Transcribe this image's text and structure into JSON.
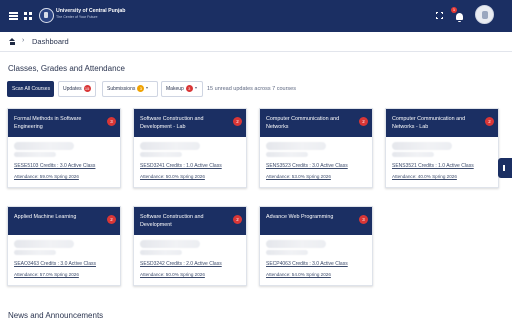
{
  "header": {
    "university_name": "University of Central Punjab",
    "tagline": "The Center of Your Future",
    "icons": [
      "menu-icon",
      "apps-icon",
      "fullscreen-icon",
      "bell-icon",
      "avatar"
    ],
    "notification_count": "1"
  },
  "breadcrumb": {
    "home_icon": "home-icon",
    "separator": "›",
    "current": "Dashboard"
  },
  "courses_section": {
    "title": "Classes, Grades and Attendance"
  },
  "filters": {
    "scan_all": "Scan All Courses",
    "updates_label": "Updates",
    "updates_count": "15",
    "submissions_label": "Submissions",
    "submissions_count": "3",
    "makeup_label": "Makeup",
    "makeup_count": "3",
    "summary": "15 unread updates across 7 courses"
  },
  "courses": [
    {
      "title": "Formal Methods in Software Engineering",
      "badge": "3",
      "code_line": "SESE5103 Credits : 3.0 Active Class",
      "attendance": "Attendance: 59.0% Spring 2026"
    },
    {
      "title": "Software Construction and Development - Lab",
      "badge": "2",
      "code_line": "SESD3241 Credits : 1.0 Active Class",
      "attendance": "Attendance: 50.0% Spring 2026"
    },
    {
      "title": "Computer Communication and Networks",
      "badge": "2",
      "code_line": "SENS3523 Credits : 3.0 Active Class",
      "attendance": "Attendance: 53.0% Spring 2026"
    },
    {
      "title": "Computer Communication and Networks - Lab",
      "badge": "2",
      "code_line": "SENS3521 Credits : 1.0 Active Class",
      "attendance": "Attendance: 40.0% Spring 2026"
    },
    {
      "title": "Applied Machine Learning",
      "badge": "2",
      "code_line": "SEAO3463 Credits : 3.0 Active Class",
      "attendance": "Attendance: 57.0% Spring 2026"
    },
    {
      "title": "Software Construction and Development",
      "badge": "2",
      "code_line": "SESD3242 Credits : 2.0 Active Class",
      "attendance": "Attendance: 50.0% Spring 2026"
    },
    {
      "title": "Advance Web Programming",
      "badge": "3",
      "code_line": "SECP4063 Credits : 3.0 Active Class",
      "attendance": "Attendance: 54.0% Spring 2026"
    }
  ],
  "news": {
    "title": "News and Announcements"
  },
  "colors": {
    "primary_navy": "#1b2f63",
    "badge_red": "#d93636",
    "badge_orange": "#f0a202"
  }
}
